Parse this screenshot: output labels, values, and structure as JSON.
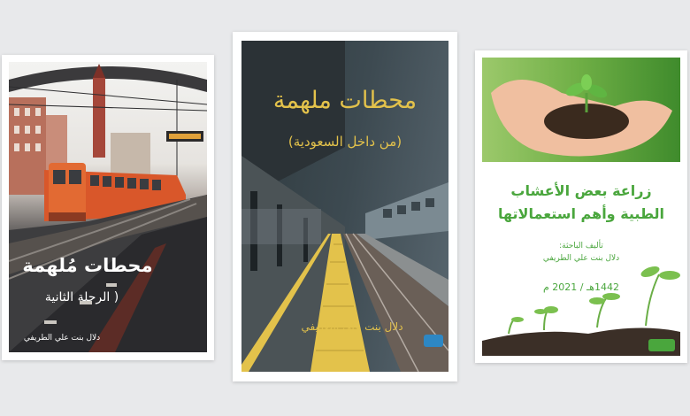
{
  "books": [
    {
      "title": "محطات مُلهمة",
      "subtitle": "( الرحلة الثانية",
      "author": "دلال بنت علي الطريفي"
    },
    {
      "title": "محطات ملهمة",
      "subtitle": "(من داخل السعودية)",
      "author": "دلال بنت علي الطريفي"
    },
    {
      "title_line1": "زراعة بعض الأعشاب",
      "title_line2": "الطبية وأهم استعمالاتها",
      "author_label": "تأليف الباحثة:",
      "author": "دلال بنت علي الطريفي",
      "date": "1442هـ / 2021 م"
    }
  ],
  "colors": {
    "background": "#e8e9eb",
    "accent_green": "#4aa63d",
    "accent_gold": "#e3c24b",
    "train_orange": "#d9572a"
  }
}
